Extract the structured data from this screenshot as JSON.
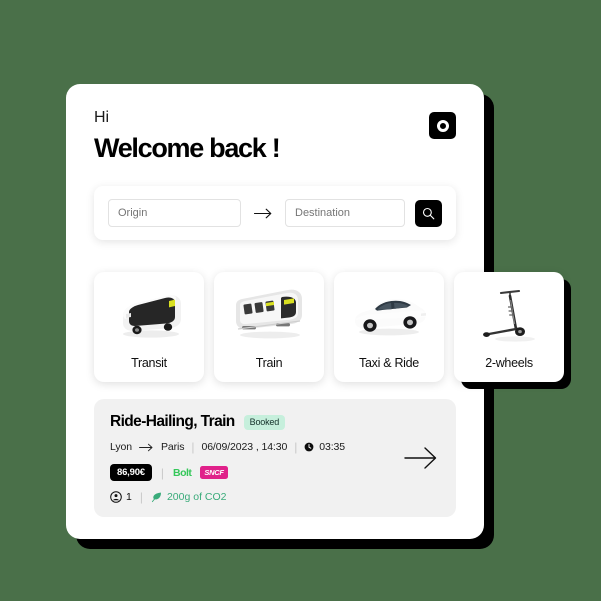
{
  "background_color": "#4a7049",
  "header": {
    "greeting": "Hi",
    "title": "Welcome back !",
    "logo_icon": "circle-dot-logo-icon"
  },
  "search": {
    "origin_placeholder": "Origin",
    "origin_value": "",
    "destination_placeholder": "Destination",
    "destination_value": "",
    "route_arrow_icon": "arrow-right-icon",
    "search_icon": "search-icon"
  },
  "modes": [
    {
      "label": "Transit",
      "icon": "bus-icon"
    },
    {
      "label": "Train",
      "icon": "tram-icon"
    },
    {
      "label": "Taxi & Ride",
      "icon": "car-icon"
    },
    {
      "label": "2-wheels",
      "icon": "scooter-icon"
    }
  ],
  "trip": {
    "title": "Ride-Hailing, Train",
    "status": "Booked",
    "status_bg": "#c6efdc",
    "origin": "Lyon",
    "destination": "Paris",
    "leg_arrow_icon": "arrow-right-icon",
    "date": "06/09/2023 , 14:30",
    "clock_icon": "clock-icon",
    "duration": "03:35",
    "price": "86,90€",
    "price_bg": "#000000",
    "operators": [
      {
        "name": "Bolt",
        "color": "#34c759"
      },
      {
        "name": "SNCF",
        "color": "#e0218a"
      }
    ],
    "passenger_icon": "person-circle-icon",
    "passenger_count": "1",
    "co2_icon": "leaf-icon",
    "co2_text": "200g of CO2",
    "co2_color": "#3aab7a",
    "cta_icon": "arrow-right-long-icon",
    "separator": "|"
  }
}
